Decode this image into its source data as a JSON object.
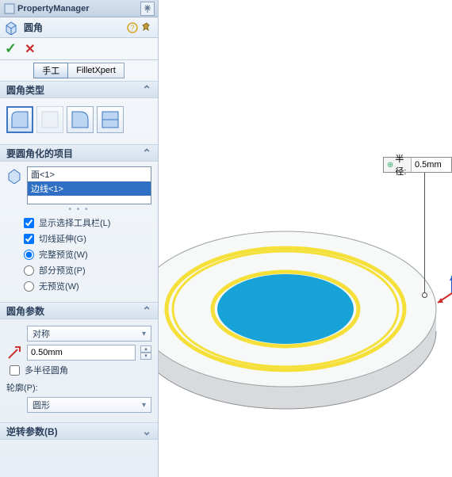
{
  "titlebar": {
    "title": "PropertyManager"
  },
  "feature": {
    "name": "圆角"
  },
  "tabs": {
    "manual": "手工",
    "xpert": "FilletXpert"
  },
  "sections": {
    "type": {
      "title": "圆角类型"
    },
    "items": {
      "title": "要圆角化的项目",
      "list": [
        "面<1>",
        "边线<1>"
      ],
      "show_toolbar": "显示选择工具栏(L)",
      "tangent": "切线延伸(G)",
      "full_preview": "完整预览(W)",
      "partial_preview": "部分预览(P)",
      "no_preview": "无预览(W)"
    },
    "params": {
      "title": "圆角参数",
      "symmetry": "对称",
      "radius": "0.50mm",
      "multi_radius": "多半径圆角",
      "profile_label": "轮廓(P):",
      "profile": "圆形"
    },
    "reverse": {
      "title": "逆转参数(B)"
    }
  },
  "callout": {
    "label": "半径:",
    "value": "0.5mm"
  },
  "colors": {
    "accent": "#2f6fc4",
    "edge_yellow": "#f5e039",
    "face_blue": "#17a2d8"
  }
}
